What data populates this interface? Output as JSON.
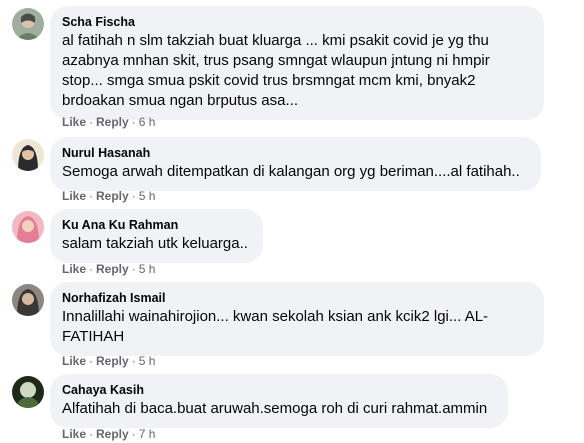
{
  "comments": [
    {
      "author": "Scha Fischa",
      "text": "al fatihah n slm takziah buat kluarga ... kmi psakit covid je yg thu azabnya mnhan skit, trus psang smngat wlaupun jntung ni hmpir stop... smga smua pskit covid trus brsmngat mcm kmi, bnyak2 brdoakan smua ngan brputus asa...",
      "like": "Like",
      "reply": "Reply",
      "time": "6 h",
      "avatar_color": "#8a9a8e"
    },
    {
      "author": "Nurul Hasanah",
      "text": "Semoga arwah ditempatkan di kalangan org yg beriman....al fatihah..",
      "like": "Like",
      "reply": "Reply",
      "time": "5 h",
      "avatar_color": "#e9dcc8"
    },
    {
      "author": "Ku Ana Ku Rahman",
      "text": "salam takziah utk keluarga..",
      "like": "Like",
      "reply": "Reply",
      "time": "5 h",
      "avatar_color": "#e79aa8"
    },
    {
      "author": "Norhafizah Ismail",
      "text": "Innalillahi wainahirojion... kwan sekolah ksian ank kcik2 lgi... AL-FATIHAH",
      "like": "Like",
      "reply": "Reply",
      "time": "5 h",
      "avatar_color": "#6f6a63"
    },
    {
      "author": "Cahaya Kasih",
      "text": "Alfatihah di baca.buat aruwah.semoga roh di curi rahmat.ammin",
      "like": "Like",
      "reply": "Reply",
      "time": "7 h",
      "avatar_color": "#2f3d2a"
    }
  ],
  "separator": "·"
}
